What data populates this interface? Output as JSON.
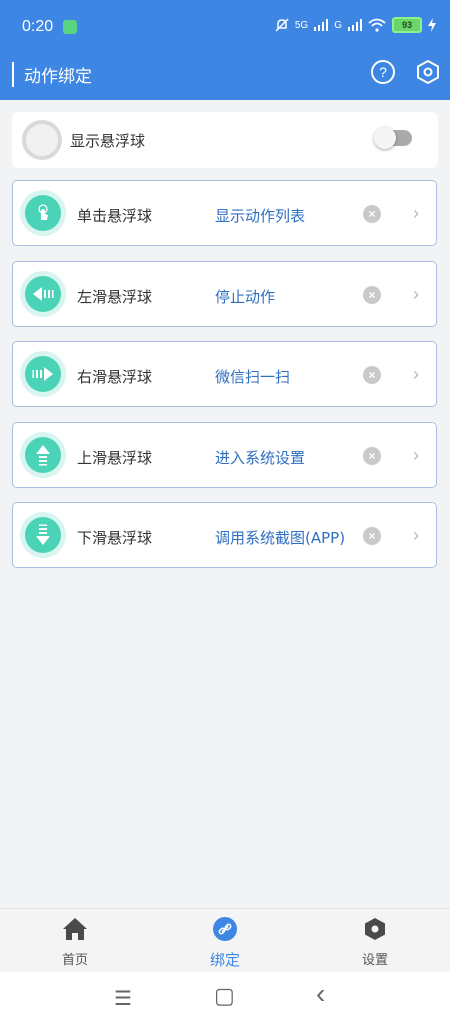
{
  "status_bar": {
    "time": "0:20",
    "network_5g": "5G",
    "network_g": "G",
    "battery": "93"
  },
  "appbar": {
    "title": "动作绑定",
    "help_label": "?"
  },
  "float_toggle": {
    "label": "显示悬浮球",
    "enabled": false
  },
  "actions": [
    {
      "gesture": "单击悬浮球",
      "action": "显示动作列表",
      "icon": "tap-icon"
    },
    {
      "gesture": "左滑悬浮球",
      "action": "停止动作",
      "icon": "swipe-left-icon"
    },
    {
      "gesture": "右滑悬浮球",
      "action": "微信扫一扫",
      "icon": "swipe-right-icon"
    },
    {
      "gesture": "上滑悬浮球",
      "action": "进入系统设置",
      "icon": "swipe-up-icon"
    },
    {
      "gesture": "下滑悬浮球",
      "action": "调用系统截图(APP)",
      "icon": "swipe-down-icon"
    }
  ],
  "clear_glyph": "×",
  "chevron_glyph": "›",
  "bottom_nav": [
    {
      "label": "首页",
      "icon": "home-icon",
      "active": false
    },
    {
      "label": "绑定",
      "icon": "link-icon",
      "active": true
    },
    {
      "label": "设置",
      "icon": "settings-icon",
      "active": false
    }
  ],
  "system_nav": {
    "menu_glyph": "☰",
    "home_glyph": "▢",
    "back_glyph": "‹"
  },
  "colors": {
    "primary": "#3d86e3",
    "accent_teal": "#4bd3b7",
    "link_blue": "#2f6fc2"
  }
}
